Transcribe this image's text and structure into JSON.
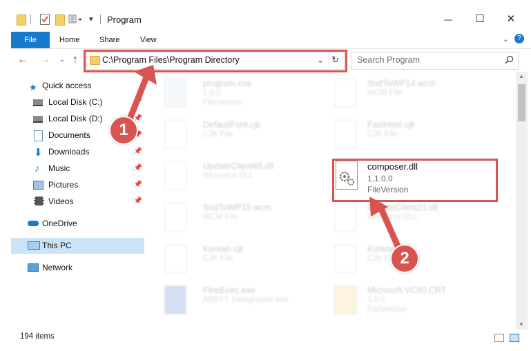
{
  "window": {
    "title": "Program",
    "controls": {
      "minimize": "—",
      "maximize": "☐",
      "close": "✕"
    }
  },
  "ribbon": {
    "tabs": [
      "File",
      "Home",
      "Share",
      "View"
    ],
    "help": "?"
  },
  "address": {
    "path": "C:\\Program Files\\Program Directory",
    "search_placeholder": "Search Program"
  },
  "nav": {
    "items": [
      {
        "label": "Quick access",
        "icon": "star-icon"
      },
      {
        "label": "Local Disk (C:)",
        "icon": "drive-icon"
      },
      {
        "label": "Local Disk (D:)",
        "icon": "drive-icon"
      },
      {
        "label": "Documents",
        "icon": "documents-icon"
      },
      {
        "label": "Downloads",
        "icon": "download-icon"
      },
      {
        "label": "Music",
        "icon": "music-icon"
      },
      {
        "label": "Pictures",
        "icon": "pictures-icon"
      },
      {
        "label": "Videos",
        "icon": "videos-icon"
      },
      {
        "label": "OneDrive",
        "icon": "cloud-icon"
      },
      {
        "label": "This PC",
        "icon": "computer-icon"
      },
      {
        "label": "Network",
        "icon": "network-icon"
      }
    ]
  },
  "files": [
    {
      "name": "program.exe",
      "line2": "1.0.0",
      "line3": "FileVersion"
    },
    {
      "name": "SndToWP14.wcm",
      "line2": "WCM File",
      "line3": ""
    },
    {
      "name": "DefaultFont.cjk",
      "line2": "CJK File",
      "line3": ""
    },
    {
      "name": "FastHtml.cjk",
      "line2": "CJK File",
      "line3": ""
    },
    {
      "name": "UpdateClient65.dll",
      "line2": "Resource DLL",
      "line3": ""
    },
    {
      "name": "SndToWP15.wcm",
      "line2": "WCM File",
      "line3": ""
    },
    {
      "name": "UpdateClient21.dll",
      "line2": "Resource DLL",
      "line3": ""
    },
    {
      "name": "Korean.cjk",
      "line2": "CJK File",
      "line3": ""
    },
    {
      "name": "Korean.cjk",
      "line2": "CJK File",
      "line3": ""
    },
    {
      "name": "FineExec.exe",
      "line2": "ABBYY background exe",
      "line3": ""
    },
    {
      "name": "Microsoft.VC90.CRT",
      "line2": "1.0.0",
      "line3": "FileVersion"
    }
  ],
  "selected_file": {
    "name": "composer.dll",
    "version": "1.1.0.0",
    "type": "FileVersion"
  },
  "status": {
    "count": "194 items"
  },
  "callouts": {
    "one": "1",
    "two": "2"
  },
  "colors": {
    "accent": "#1979ca",
    "highlight": "#d9534f",
    "selection": "#cce4f7"
  }
}
